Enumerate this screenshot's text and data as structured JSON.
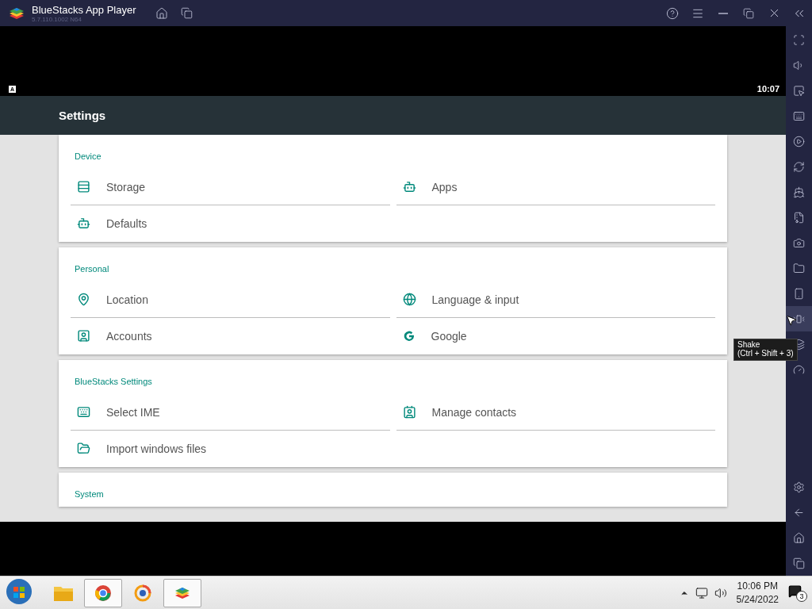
{
  "window": {
    "title": "BlueStacks App Player",
    "version": "5.7.110.1002 N64"
  },
  "android": {
    "status_badge": "A",
    "clock": "10:07",
    "toolbar_title": "Settings",
    "sections": [
      {
        "title": "Device",
        "items": [
          {
            "label": "Storage"
          },
          {
            "label": "Apps"
          },
          {
            "label": "Defaults"
          }
        ]
      },
      {
        "title": "Personal",
        "items": [
          {
            "label": "Location"
          },
          {
            "label": "Language & input"
          },
          {
            "label": "Accounts"
          },
          {
            "label": "Google"
          }
        ]
      },
      {
        "title": "BlueStacks Settings",
        "items": [
          {
            "label": "Select IME"
          },
          {
            "label": "Manage contacts"
          },
          {
            "label": "Import windows files"
          }
        ]
      },
      {
        "title": "System"
      }
    ]
  },
  "sidebar": {
    "tools": [
      {
        "hovered": false
      },
      {
        "hovered": false
      },
      {
        "hovered": false
      },
      {
        "hovered": false
      },
      {
        "hovered": false
      },
      {
        "hovered": false
      },
      {
        "hovered": false
      },
      {
        "hovered": false
      },
      {
        "hovered": false
      },
      {
        "hovered": false
      },
      {
        "hovered": false
      },
      {
        "hovered": true
      },
      {
        "hovered": false
      },
      {
        "hovered": false
      }
    ],
    "tooltip": {
      "title": "Shake",
      "shortcut": "(Ctrl + Shift + 3)"
    }
  },
  "taskbar": {
    "apps": [
      {
        "open": false
      },
      {
        "open": true
      },
      {
        "open": false
      },
      {
        "open": true
      }
    ],
    "time": "10:06 PM",
    "date": "5/24/2022",
    "notifications": "3"
  }
}
